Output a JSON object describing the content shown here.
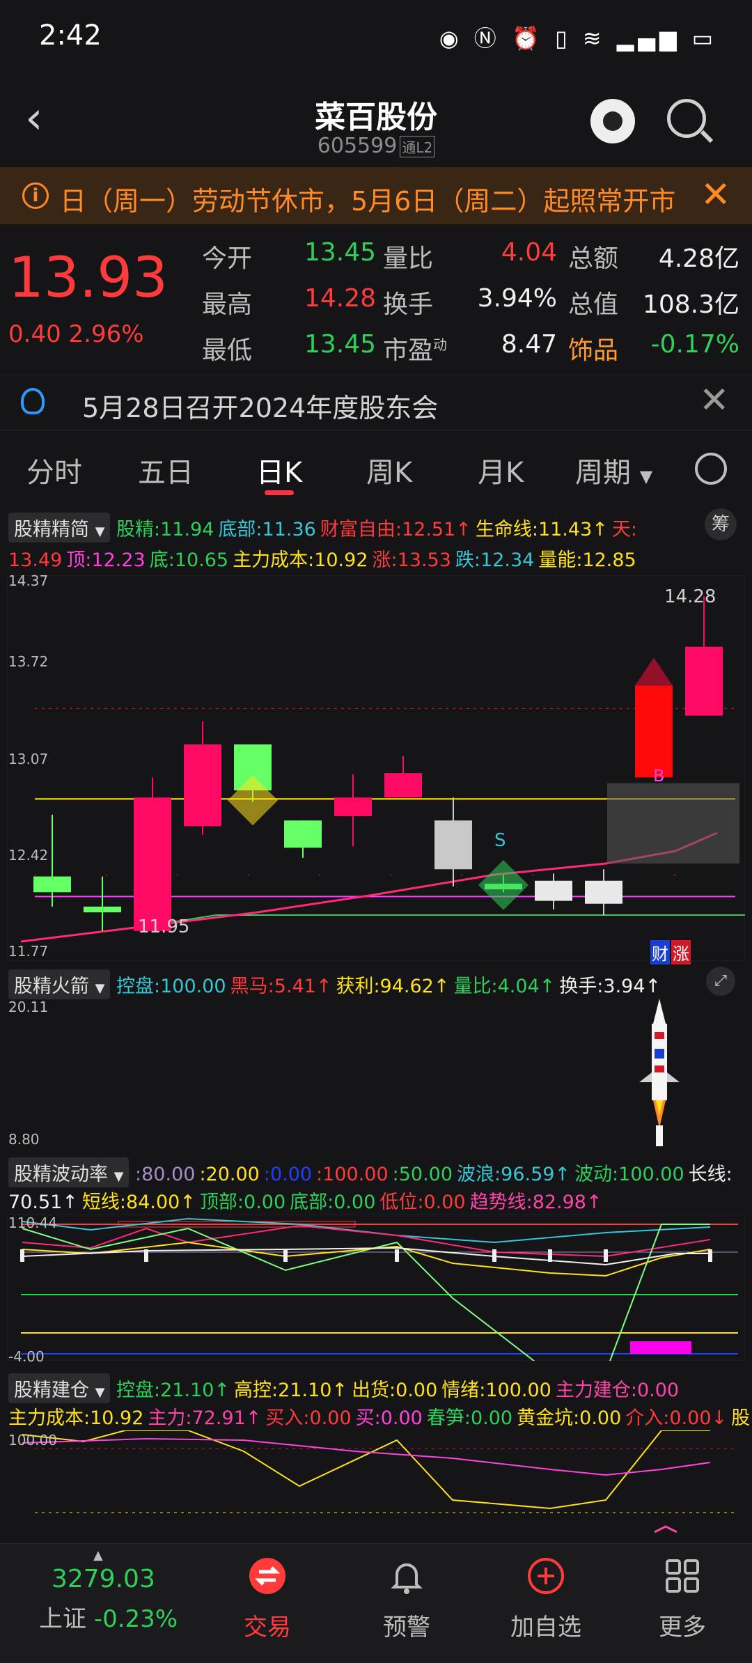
{
  "status": {
    "time": "2:42",
    "icons": [
      "eye-icon",
      "nfc-icon",
      "alarm-icon",
      "vibrate-icon",
      "wifi-icon",
      "signal-5g-icon",
      "battery-icon"
    ]
  },
  "header": {
    "title": "菜百股份",
    "code": "605599",
    "tag": "通L2"
  },
  "notice": {
    "text": "日（周一）劳动节休市，5月6日（周二）起照常开市；"
  },
  "quote": {
    "price": "13.93",
    "change": "0.40",
    "change_pct": "2.96%",
    "rows": [
      [
        {
          "l": "今开",
          "v": "13.45",
          "c": "green"
        },
        {
          "l": "量比",
          "v": "4.04",
          "c": "red"
        },
        {
          "l": "总额",
          "v": "4.28亿",
          "c": "white"
        }
      ],
      [
        {
          "l": "最高",
          "v": "14.28",
          "c": "red"
        },
        {
          "l": "换手",
          "v": "3.94%",
          "c": "white"
        },
        {
          "l": "总值",
          "v": "108.3亿",
          "c": "white"
        }
      ],
      [
        {
          "l": "最低",
          "v": "13.45",
          "c": "green"
        },
        {
          "l": "市盈",
          "sup": "动",
          "v": "8.47",
          "c": "white"
        },
        {
          "l": "饰品",
          "v": "-0.17%",
          "c": "green",
          "lc": "orange"
        }
      ]
    ]
  },
  "meeting": {
    "text": "5月28日召开2024年度股东会"
  },
  "tabs": [
    "分时",
    "五日",
    "日K",
    "周K",
    "月K",
    "周期"
  ],
  "ind1": {
    "selector": "股精精简",
    "badge": "筹",
    "line1": [
      {
        "t": "股精:11.94",
        "c": "#2fd05a"
      },
      {
        "t": "底部:11.36",
        "c": "#36c7d6"
      },
      {
        "t": "财富自由:12.51↑",
        "c": "#ff3b3b"
      },
      {
        "t": "生命线:11.43↑",
        "c": "#ffe21a"
      },
      {
        "t": "天:",
        "c": "#ff3b3b"
      }
    ],
    "line2": [
      {
        "t": "13.49",
        "c": "#ff3b3b"
      },
      {
        "t": "顶:12.23",
        "c": "#ff44dd"
      },
      {
        "t": "底:10.65",
        "c": "#2fd05a"
      },
      {
        "t": "主力成本:10.92",
        "c": "#ffe21a"
      },
      {
        "t": "涨:13.53",
        "c": "#ff3b3b"
      },
      {
        "t": "跌:12.34",
        "c": "#36c7d6"
      },
      {
        "t": "量能:12.85",
        "c": "#ffe21a"
      }
    ]
  },
  "kchart": {
    "ylabels": [
      "14.37",
      "13.72",
      "13.07",
      "12.42",
      "11.77"
    ],
    "high_label": "14.28",
    "low_label": "11.95",
    "marks": {
      "s": "S",
      "b": "B",
      "cai": "财",
      "zhang": "涨"
    }
  },
  "chart_data": {
    "type": "candlestick",
    "ylim": [
      11.77,
      14.37
    ],
    "candles": [
      {
        "o": 12.33,
        "c": 12.22,
        "h": 12.76,
        "l": 12.12,
        "color": "green"
      },
      {
        "o": 12.12,
        "c": 12.08,
        "h": 12.33,
        "l": 11.95,
        "color": "green"
      },
      {
        "o": 11.95,
        "c": 12.88,
        "h": 13.02,
        "l": 11.95,
        "color": "red"
      },
      {
        "o": 12.68,
        "c": 13.25,
        "h": 13.41,
        "l": 12.62,
        "color": "red"
      },
      {
        "o": 13.25,
        "c": 12.93,
        "h": 13.25,
        "l": 12.85,
        "color": "green"
      },
      {
        "o": 12.72,
        "c": 12.53,
        "h": 12.72,
        "l": 12.46,
        "color": "green"
      },
      {
        "o": 12.75,
        "c": 12.88,
        "h": 13.04,
        "l": 12.54,
        "color": "red"
      },
      {
        "o": 12.88,
        "c": 13.05,
        "h": 13.17,
        "l": 12.88,
        "color": "red"
      },
      {
        "o": 12.72,
        "c": 12.38,
        "h": 12.88,
        "l": 12.26,
        "color": "white"
      },
      {
        "o": 12.28,
        "c": 12.24,
        "h": 12.34,
        "l": 12.22,
        "color": "green"
      },
      {
        "o": 12.3,
        "c": 12.16,
        "h": 12.35,
        "l": 12.1,
        "color": "white"
      },
      {
        "o": 12.3,
        "c": 12.14,
        "h": 12.38,
        "l": 12.06,
        "color": "white"
      },
      {
        "o": 13.02,
        "c": 13.66,
        "h": 13.66,
        "l": 13.02,
        "color": "red"
      },
      {
        "o": 13.45,
        "c": 13.93,
        "h": 14.28,
        "l": 13.45,
        "color": "red"
      }
    ]
  },
  "ind2": {
    "selector": "股精火箭",
    "line": [
      {
        "t": "控盘:100.00",
        "c": "#36c7d6"
      },
      {
        "t": "黑马:5.41↑",
        "c": "#ff3b3b"
      },
      {
        "t": "获利:94.62↑",
        "c": "#ffe21a"
      },
      {
        "t": "量比:4.04↑",
        "c": "#2fd05a"
      },
      {
        "t": "换手:3.94↑",
        "c": "#f0f0f0"
      }
    ],
    "ylabels": [
      "20.11",
      "8.80"
    ]
  },
  "ind3": {
    "selector": "股精波动率",
    "line1": [
      {
        "t": ":80.00",
        "c": "#a88cc8"
      },
      {
        "t": ":20.00",
        "c": "#ffe21a"
      },
      {
        "t": ":0.00",
        "c": "#2040ff"
      },
      {
        "t": ":100.00",
        "c": "#ff3b3b"
      },
      {
        "t": ":50.00",
        "c": "#2fd05a"
      },
      {
        "t": "波浪:96.59↑",
        "c": "#36c7d6"
      },
      {
        "t": "波动:100.00",
        "c": "#2fd05a"
      },
      {
        "t": "长线:",
        "c": "#f0f0f0"
      }
    ],
    "line2": [
      {
        "t": "70.51↑",
        "c": "#f0f0f0"
      },
      {
        "t": "短线:84.00↑",
        "c": "#ffe21a"
      },
      {
        "t": "顶部:0.00",
        "c": "#2fd05a"
      },
      {
        "t": "底部:0.00",
        "c": "#2fd05a"
      },
      {
        "t": "低位:0.00",
        "c": "#ff3b3b"
      },
      {
        "t": "趋势线:82.98↑",
        "c": "#ff44aa"
      }
    ],
    "ylabels": [
      "110.44",
      "-4.00"
    ]
  },
  "ind4": {
    "selector": "股精建仓",
    "line1": [
      {
        "t": "控盘:21.10↑",
        "c": "#2fd05a"
      },
      {
        "t": "高控:21.10↑",
        "c": "#ffe21a"
      },
      {
        "t": "出货:0.00",
        "c": "#ffe21a"
      },
      {
        "t": "情绪:100.00",
        "c": "#ffe21a"
      },
      {
        "t": "主力建仓:0.00",
        "c": "#ff44aa"
      }
    ],
    "line2": [
      {
        "t": "主力成本:10.92",
        "c": "#ffe21a"
      },
      {
        "t": "主力:72.91↑",
        "c": "#ff44aa"
      },
      {
        "t": "买入:0.00",
        "c": "#ff3b3b"
      },
      {
        "t": "买:0.00",
        "c": "#ff44dd"
      },
      {
        "t": "春笋:0.00",
        "c": "#2fd05a"
      },
      {
        "t": "黄金坑:0.00",
        "c": "#ffe21a"
      },
      {
        "t": "介入:0.00↓",
        "c": "#ff3b3b"
      },
      {
        "t": "股",
        "c": "#ffe21a"
      }
    ],
    "ylabels": [
      "100.00"
    ]
  },
  "bottom": {
    "index_value": "3279.03",
    "index_name": "上证",
    "index_pct": "-0.23%",
    "items": [
      "交易",
      "预警",
      "加自选",
      "更多"
    ]
  }
}
